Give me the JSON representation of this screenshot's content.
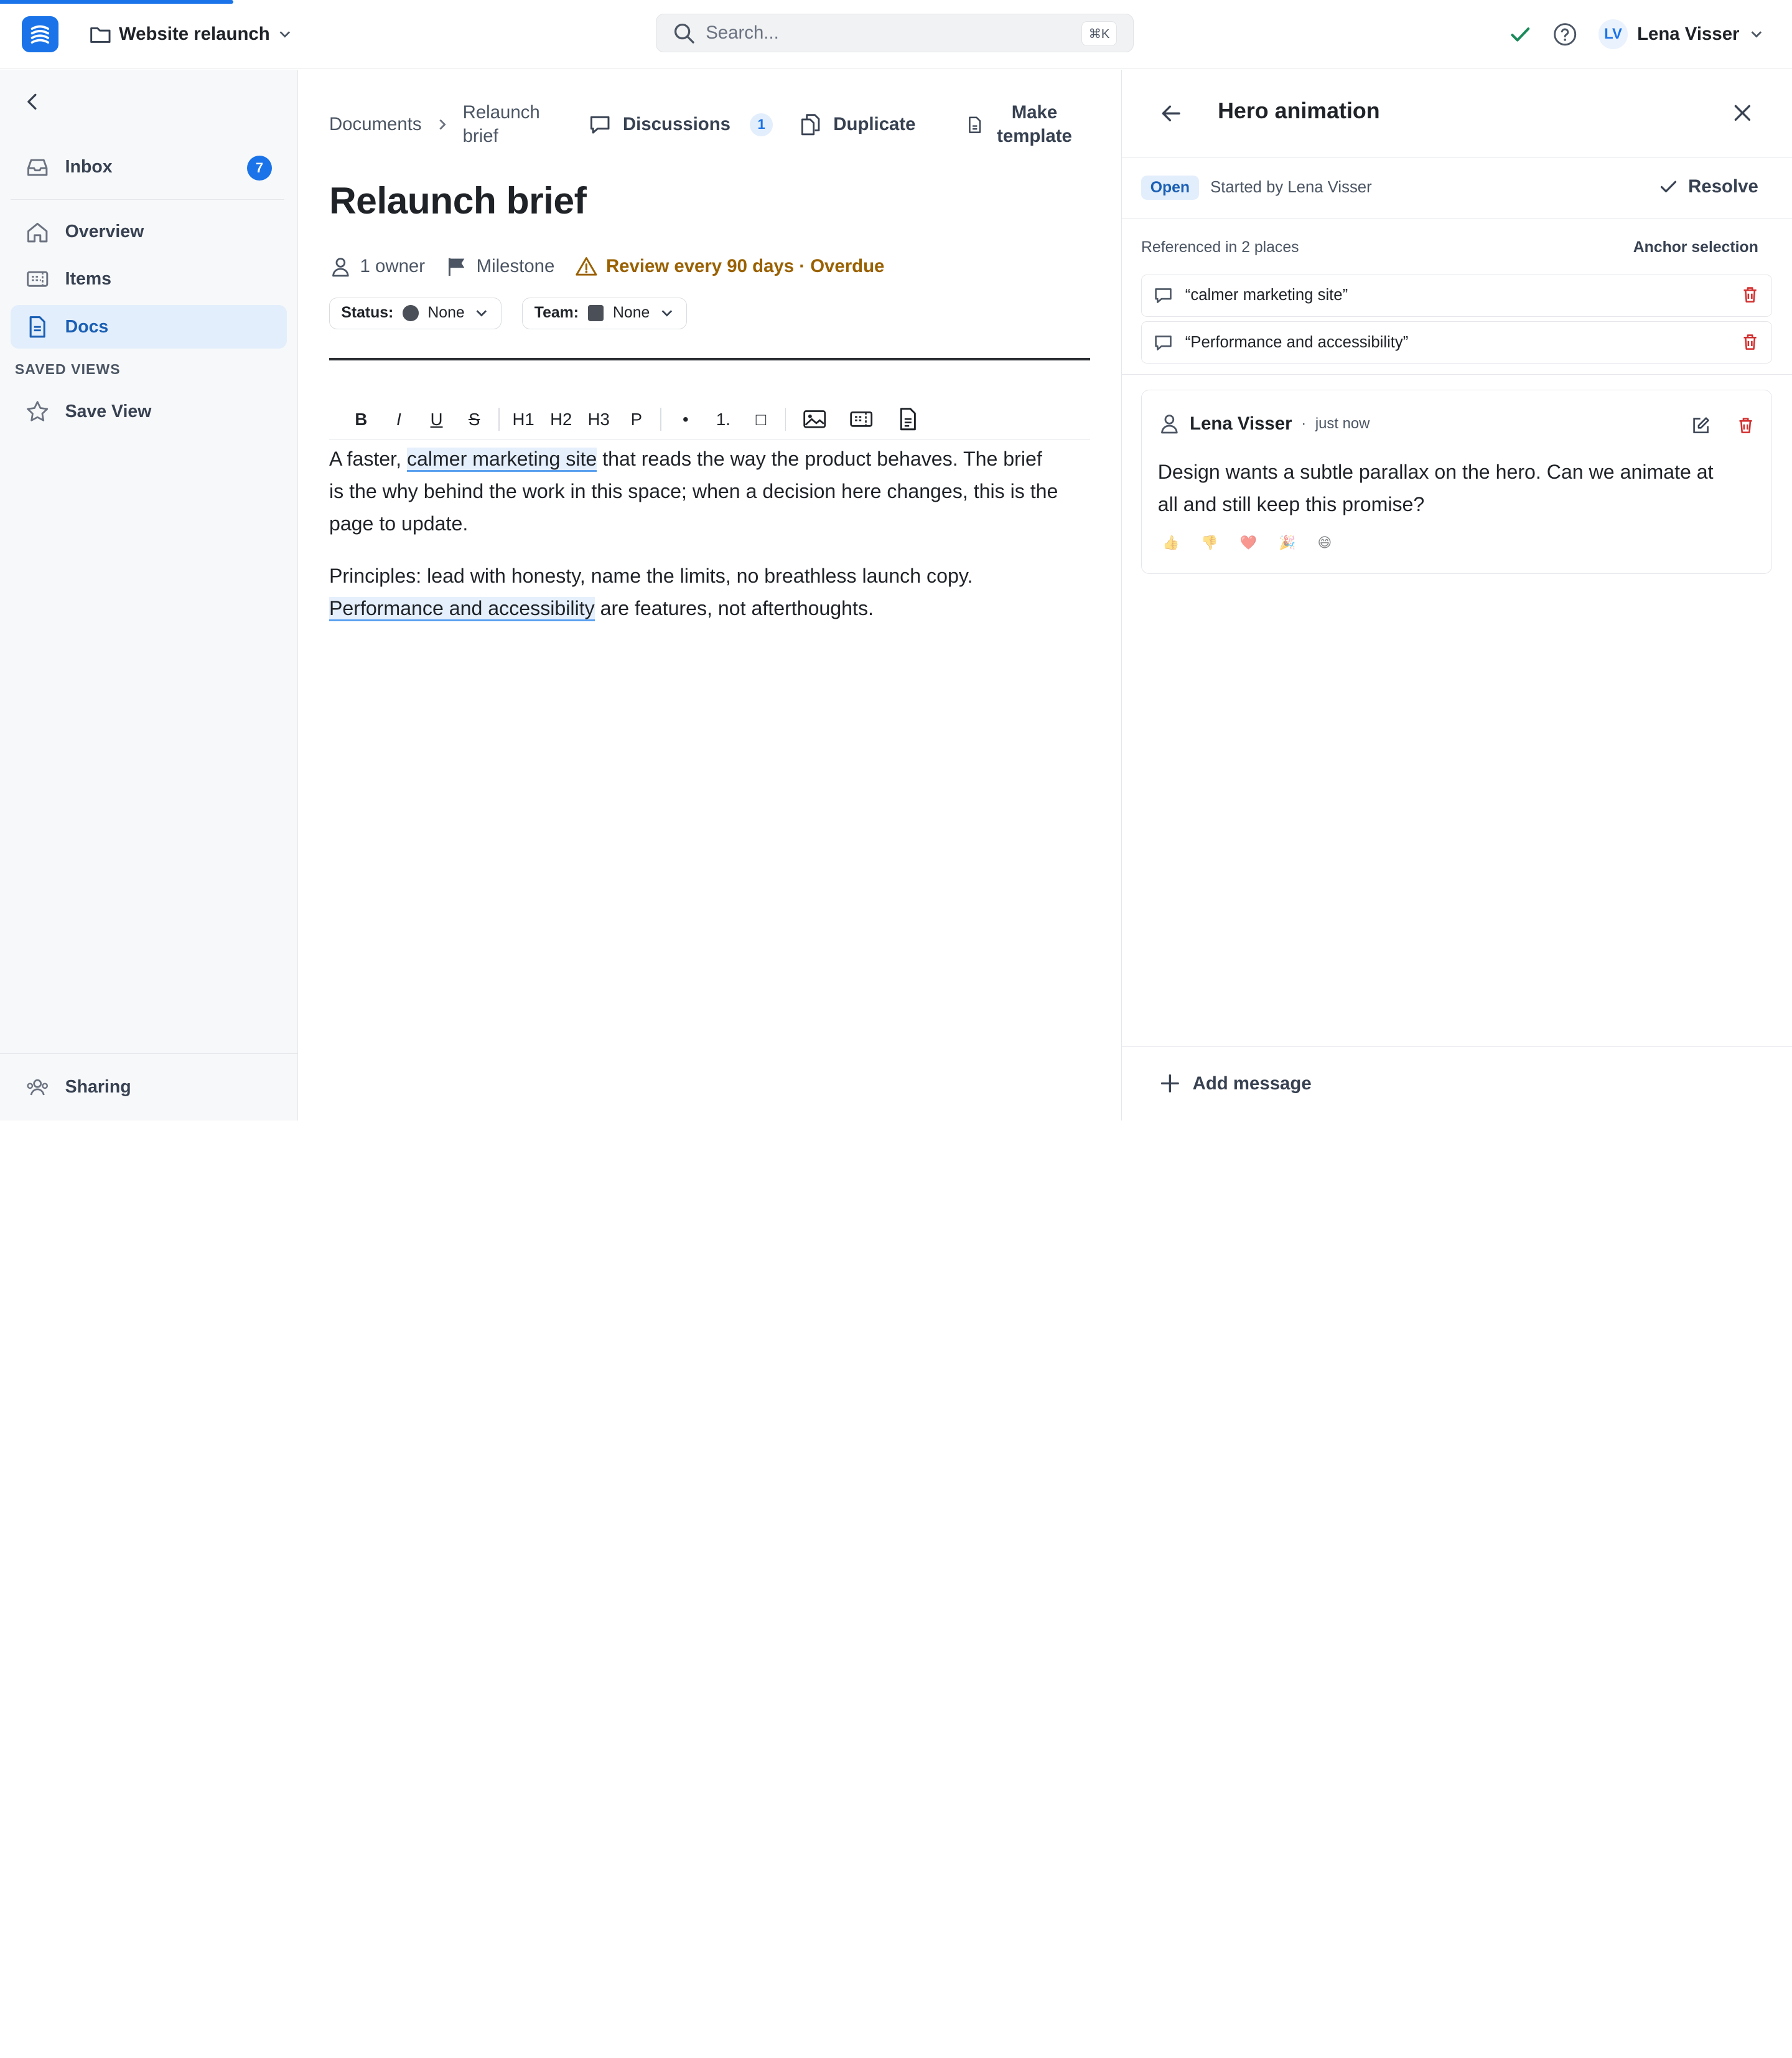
{
  "app": {
    "accent": "#1a73e8",
    "workspace": "Website relaunch"
  },
  "search": {
    "placeholder": "Search...",
    "shortcut": "⌘K"
  },
  "user": {
    "initials": "LV",
    "name": "Lena Visser"
  },
  "sidebar": {
    "items": [
      {
        "label": "Inbox",
        "icon": "inbox-icon",
        "badge": "7"
      },
      {
        "label": "Overview",
        "icon": "home-icon"
      },
      {
        "label": "Items",
        "icon": "ticket-icon"
      },
      {
        "label": "Docs",
        "icon": "document-icon",
        "active": true
      }
    ],
    "saved_views_title": "SAVED VIEWS",
    "save_view": "Save View",
    "sharing": "Sharing"
  },
  "doc": {
    "breadcrumb": [
      "Documents",
      "Relaunch brief"
    ],
    "actions": {
      "discussions": "Discussions",
      "discussions_count": "1",
      "duplicate": "Duplicate",
      "make_template": "Make template"
    },
    "title": "Relaunch brief",
    "meta": {
      "owners": "1 owner",
      "milestone": "Milestone",
      "review": "Review every 90 days · Overdue"
    },
    "status": {
      "label": "Status:",
      "value": "None"
    },
    "team": {
      "label": "Team:",
      "value": "None"
    },
    "toolbar": [
      "B",
      "I",
      "U",
      "S",
      "H1",
      "H2",
      "H3",
      "P",
      "•",
      "1.",
      "□"
    ],
    "paragraphs": [
      {
        "before": "A faster, ",
        "highlight": "calmer marketing site",
        "after": " that reads the way the product behaves. The brief is the why behind the work in this space; when a decision here changes, this is the page to update."
      },
      {
        "before": "Principles: lead with honesty, name the limits, no breathless launch copy. ",
        "highlight": "Performance and accessibility",
        "after": " are features, not afterthoughts."
      }
    ]
  },
  "discussion": {
    "title": "Hero animation",
    "status": "Open",
    "started_by": "Started by Lena Visser",
    "resolve": "Resolve",
    "referenced": "Referenced in 2 places",
    "anchor_selection": "Anchor selection",
    "references": [
      "“calmer marketing site”",
      "“Performance and accessibility”"
    ],
    "comment": {
      "author": "Lena Visser",
      "time": "just now",
      "text": "Design wants a subtle parallax on the hero. Can we animate at all and still keep this promise?",
      "reactions": [
        "👍",
        "👎",
        "❤️",
        "🎉",
        "😄"
      ]
    },
    "add_message": "Add message"
  }
}
